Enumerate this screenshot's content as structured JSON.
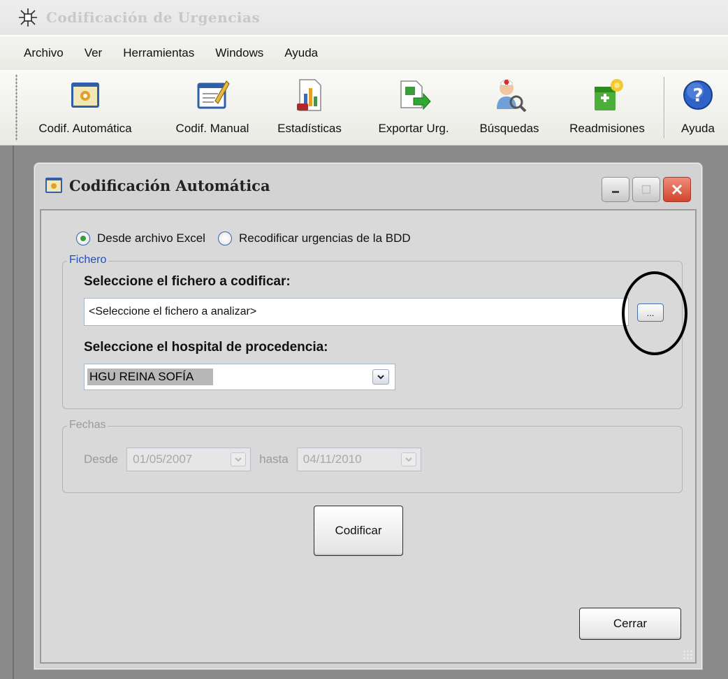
{
  "app": {
    "title": "Codificación de Urgencias"
  },
  "menubar": {
    "items": [
      "Archivo",
      "Ver",
      "Herramientas",
      "Windows",
      "Ayuda"
    ]
  },
  "toolbar": {
    "buttons": [
      {
        "label": "Codif. Automática",
        "icon": "auto-coding-icon"
      },
      {
        "label": "Codif. Manual",
        "icon": "manual-coding-icon"
      },
      {
        "label": "Estadísticas",
        "icon": "statistics-icon"
      },
      {
        "label": "Exportar Urg.",
        "icon": "export-excel-icon"
      },
      {
        "label": "Búsquedas",
        "icon": "search-doctor-icon"
      },
      {
        "label": "Readmisiones",
        "icon": "readmissions-icon"
      },
      {
        "label": "Ayuda",
        "icon": "help-icon"
      }
    ]
  },
  "dialog": {
    "title": "Codificación Automática",
    "source_options": [
      {
        "label": "Desde archivo Excel",
        "selected": true
      },
      {
        "label": "Recodificar urgencias de la BDD",
        "selected": false
      }
    ],
    "fichero_group": {
      "legend": "Fichero",
      "file_label": "Seleccione el fichero a codificar:",
      "file_value": "<Seleccione el fichero a analizar>",
      "browse_label": "...",
      "hospital_label": "Seleccione el hospital de procedencia:",
      "hospital_value": "HGU REINA SOFÍA"
    },
    "fechas_group": {
      "legend": "Fechas",
      "from_label": "Desde",
      "from_value": "01/05/2007",
      "to_label": "hasta",
      "to_value": "04/11/2010"
    },
    "codificar_label": "Codificar",
    "cerrar_label": "Cerrar"
  },
  "colors": {
    "mdi_background": "#8a8a8a",
    "dialog_background": "#d9d9d9",
    "legend_blue": "#1f4fbf",
    "close_red": "#d0452e"
  }
}
